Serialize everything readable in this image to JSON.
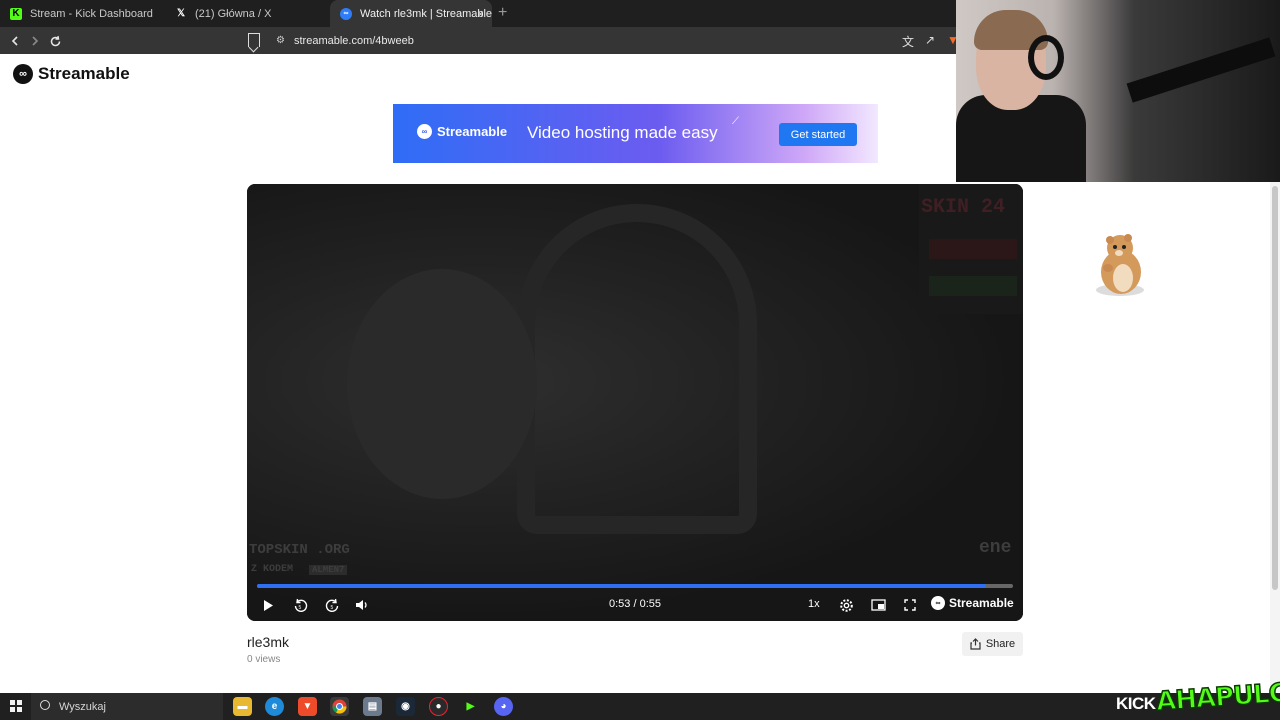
{
  "browser": {
    "tabs": [
      {
        "label": "Stream - Kick Dashboard",
        "favicon": "kick-icon",
        "active": false
      },
      {
        "label": "(21) Główna / X",
        "favicon": "x-icon",
        "active": false
      },
      {
        "label": "Watch rle3mk | Streamable",
        "favicon": "streamable-icon",
        "active": true
      }
    ],
    "new_tab": "+",
    "close_tab": "×",
    "url": "streamable.com/4bweeb"
  },
  "site": {
    "brand": "Streamable",
    "banner": {
      "brand": "Streamable",
      "tagline": "Video hosting made easy",
      "cta": "Get started"
    }
  },
  "player": {
    "time": "0:53 / 0:55",
    "progress": 0.964,
    "speed": "1x",
    "brand": "Streamable",
    "overlay_texts": {
      "topskin": "TOPSKIN .ORG",
      "kod": "Z KODEM",
      "code": "ALMEN7",
      "enel": "ene",
      "banner_top": "SKIN 24"
    }
  },
  "video_info": {
    "title": "rle3mk",
    "views": "0 views",
    "share": "Share"
  },
  "taskbar": {
    "search_placeholder": "Wyszukaj",
    "kick_label": "KICK",
    "stream_logo": "AHAPULCO"
  },
  "colors": {
    "accent": "#2e6ff3",
    "cta": "#1f78f2",
    "kick_green": "#53fc18"
  }
}
